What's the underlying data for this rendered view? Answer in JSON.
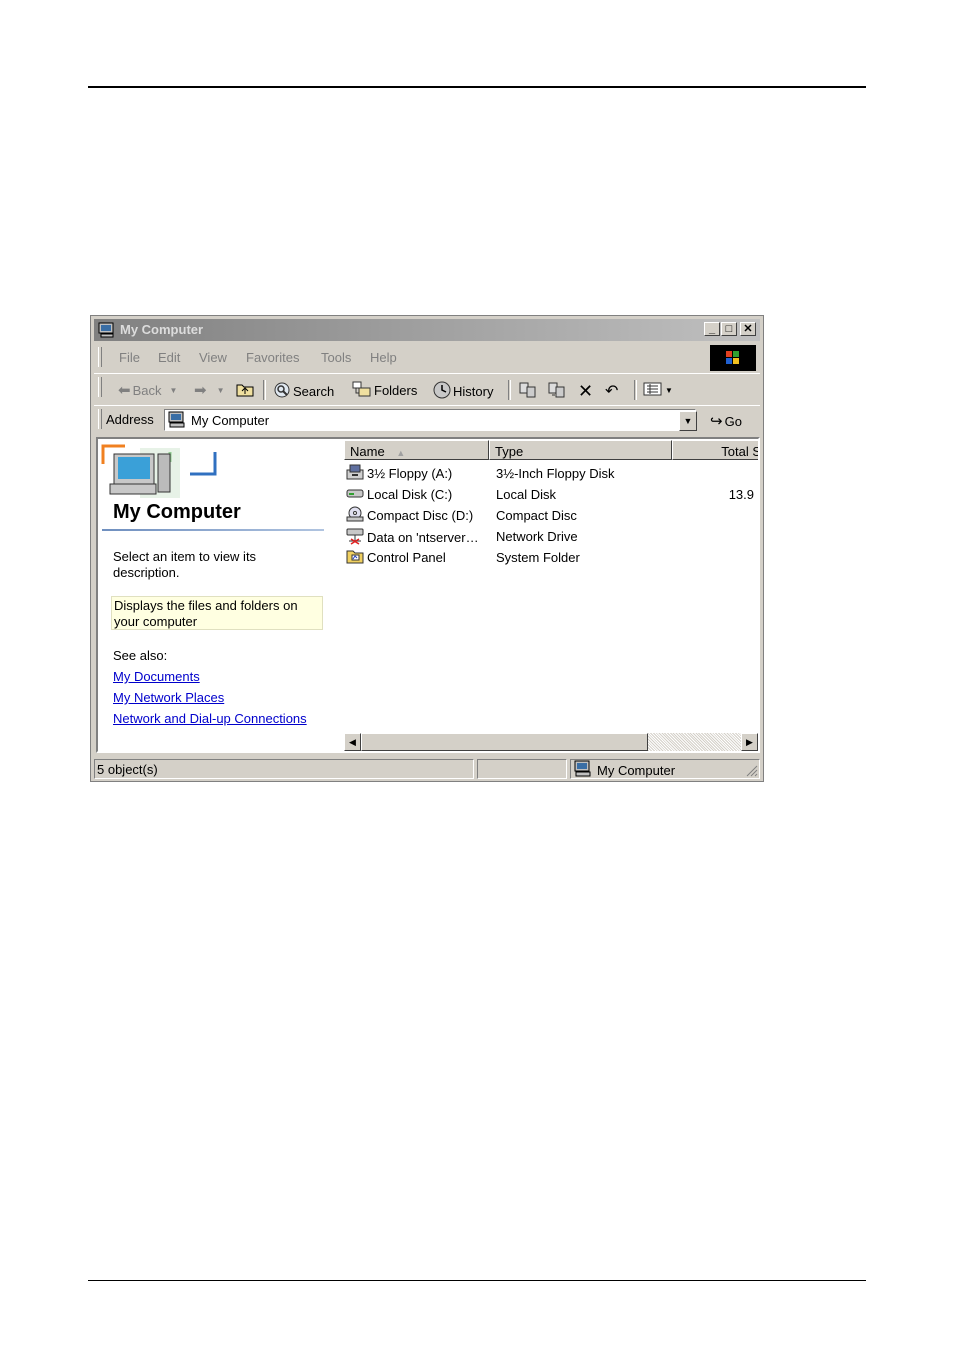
{
  "window": {
    "title": "My Computer"
  },
  "menu": [
    "File",
    "Edit",
    "View",
    "Favorites",
    "Tools",
    "Help"
  ],
  "toolbar": {
    "back": "Back",
    "search": "Search",
    "folders": "Folders",
    "history": "History"
  },
  "address": {
    "label": "Address",
    "value": "My Computer",
    "go": "Go"
  },
  "left_pane": {
    "title": "My Computer",
    "select_text": "Select an item to view its description.",
    "description": "Displays the files and folders on your computer",
    "see_also": "See also:",
    "links": [
      "My Documents",
      "My Network Places",
      "Network and Dial-up Connections"
    ]
  },
  "columns": {
    "name": "Name",
    "type": "Type",
    "total": "Total S"
  },
  "items": [
    {
      "name": "3½ Floppy (A:)",
      "type": "3½-Inch Floppy Disk",
      "size": "",
      "icon": "floppy-drive-icon"
    },
    {
      "name": "Local Disk (C:)",
      "type": "Local Disk",
      "size": "13.9",
      "icon": "hard-disk-icon"
    },
    {
      "name": "Compact Disc (D:)",
      "type": "Compact Disc",
      "size": "",
      "icon": "cd-drive-icon"
    },
    {
      "name": "Data on 'ntserver…",
      "type": "Network Drive",
      "size": "",
      "icon": "network-drive-icon"
    },
    {
      "name": "Control Panel",
      "type": "System Folder",
      "size": "",
      "icon": "control-panel-icon"
    }
  ],
  "status": {
    "objects": "5 object(s)",
    "location": "My Computer"
  }
}
